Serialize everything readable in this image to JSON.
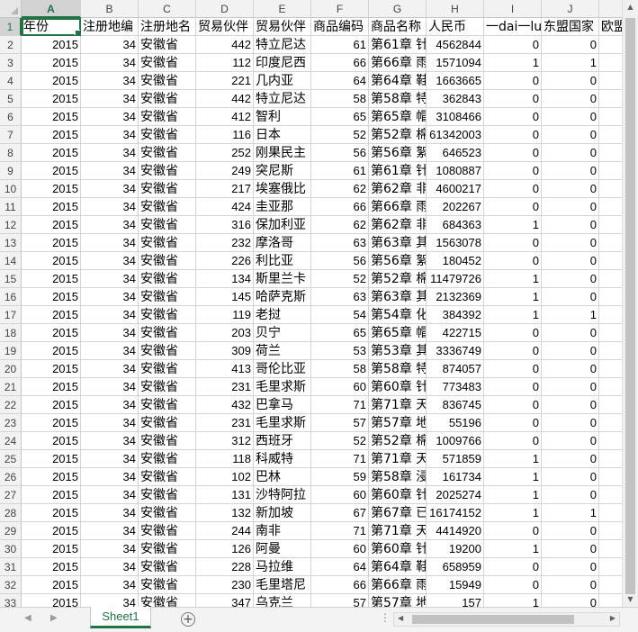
{
  "columns": [
    {
      "letter": "A",
      "width": 66
    },
    {
      "letter": "B",
      "width": 64
    },
    {
      "letter": "C",
      "width": 64
    },
    {
      "letter": "D",
      "width": 64
    },
    {
      "letter": "E",
      "width": 64
    },
    {
      "letter": "F",
      "width": 64
    },
    {
      "letter": "G",
      "width": 64
    },
    {
      "letter": "H",
      "width": 64
    },
    {
      "letter": "I",
      "width": 64
    },
    {
      "letter": "J",
      "width": 64
    },
    {
      "letter": "",
      "width": 30
    }
  ],
  "header_row": [
    "年份",
    "注册地编",
    "注册地名",
    "贸易伙伴",
    "贸易伙伴",
    "商品编码",
    "商品名称",
    "人民币",
    "一dai一lu",
    "东盟国家",
    "欧盟"
  ],
  "col_align": [
    "num",
    "num",
    "txt",
    "num",
    "txt",
    "num",
    "txt",
    "num",
    "num",
    "num",
    "num"
  ],
  "rows": [
    [
      "2015",
      "34",
      "安徽省",
      "442",
      "特立尼达",
      "61",
      "第61章 针",
      "4562844",
      "0",
      "0",
      ""
    ],
    [
      "2015",
      "34",
      "安徽省",
      "112",
      "印度尼西",
      "66",
      "第66章 雨",
      "1571094",
      "1",
      "1",
      ""
    ],
    [
      "2015",
      "34",
      "安徽省",
      "221",
      "几内亚",
      "64",
      "第64章 鞋",
      "1663665",
      "0",
      "0",
      ""
    ],
    [
      "2015",
      "34",
      "安徽省",
      "442",
      "特立尼达",
      "58",
      "第58章 特",
      "362843",
      "0",
      "0",
      ""
    ],
    [
      "2015",
      "34",
      "安徽省",
      "412",
      "智利",
      "65",
      "第65章 帽",
      "3108466",
      "0",
      "0",
      ""
    ],
    [
      "2015",
      "34",
      "安徽省",
      "116",
      "日本",
      "52",
      "第52章 棉",
      "61342003",
      "0",
      "0",
      ""
    ],
    [
      "2015",
      "34",
      "安徽省",
      "252",
      "刚果民主",
      "56",
      "第56章 絮",
      "646523",
      "0",
      "0",
      ""
    ],
    [
      "2015",
      "34",
      "安徽省",
      "249",
      "突尼斯",
      "61",
      "第61章 针",
      "1080887",
      "0",
      "0",
      ""
    ],
    [
      "2015",
      "34",
      "安徽省",
      "217",
      "埃塞俄比",
      "62",
      "第62章 非",
      "4600217",
      "0",
      "0",
      ""
    ],
    [
      "2015",
      "34",
      "安徽省",
      "424",
      "圭亚那",
      "66",
      "第66章 雨",
      "202267",
      "0",
      "0",
      ""
    ],
    [
      "2015",
      "34",
      "安徽省",
      "316",
      "保加利亚",
      "62",
      "第62章 非",
      "684363",
      "1",
      "0",
      ""
    ],
    [
      "2015",
      "34",
      "安徽省",
      "232",
      "摩洛哥",
      "63",
      "第63章 其",
      "1563078",
      "0",
      "0",
      ""
    ],
    [
      "2015",
      "34",
      "安徽省",
      "226",
      "利比亚",
      "56",
      "第56章 絮",
      "180452",
      "0",
      "0",
      ""
    ],
    [
      "2015",
      "34",
      "安徽省",
      "134",
      "斯里兰卡",
      "52",
      "第52章 棉",
      "11479726",
      "1",
      "0",
      ""
    ],
    [
      "2015",
      "34",
      "安徽省",
      "145",
      "哈萨克斯",
      "63",
      "第63章 其",
      "2132369",
      "1",
      "0",
      ""
    ],
    [
      "2015",
      "34",
      "安徽省",
      "119",
      "老挝",
      "54",
      "第54章 化",
      "384392",
      "1",
      "1",
      ""
    ],
    [
      "2015",
      "34",
      "安徽省",
      "203",
      "贝宁",
      "65",
      "第65章 帽",
      "422715",
      "0",
      "0",
      ""
    ],
    [
      "2015",
      "34",
      "安徽省",
      "309",
      "荷兰",
      "53",
      "第53章 其",
      "3336749",
      "0",
      "0",
      ""
    ],
    [
      "2015",
      "34",
      "安徽省",
      "413",
      "哥伦比亚",
      "58",
      "第58章 特",
      "874057",
      "0",
      "0",
      ""
    ],
    [
      "2015",
      "34",
      "安徽省",
      "231",
      "毛里求斯",
      "60",
      "第60章 针",
      "773483",
      "0",
      "0",
      ""
    ],
    [
      "2015",
      "34",
      "安徽省",
      "432",
      "巴拿马",
      "71",
      "第71章 天",
      "836745",
      "0",
      "0",
      ""
    ],
    [
      "2015",
      "34",
      "安徽省",
      "231",
      "毛里求斯",
      "57",
      "第57章 地",
      "55196",
      "0",
      "0",
      ""
    ],
    [
      "2015",
      "34",
      "安徽省",
      "312",
      "西班牙",
      "52",
      "第52章 棉",
      "1009766",
      "0",
      "0",
      ""
    ],
    [
      "2015",
      "34",
      "安徽省",
      "118",
      "科威特",
      "71",
      "第71章 天",
      "571859",
      "1",
      "0",
      ""
    ],
    [
      "2015",
      "34",
      "安徽省",
      "102",
      "巴林",
      "59",
      "第58章 浸",
      "161734",
      "1",
      "0",
      ""
    ],
    [
      "2015",
      "34",
      "安徽省",
      "131",
      "沙特阿拉",
      "60",
      "第60章 针",
      "2025274",
      "1",
      "0",
      ""
    ],
    [
      "2015",
      "34",
      "安徽省",
      "132",
      "新加坡",
      "67",
      "第67章 已",
      "16174152",
      "1",
      "1",
      ""
    ],
    [
      "2015",
      "34",
      "安徽省",
      "244",
      "南非",
      "71",
      "第71章 天",
      "4414920",
      "0",
      "0",
      ""
    ],
    [
      "2015",
      "34",
      "安徽省",
      "126",
      "阿曼",
      "60",
      "第60章 针",
      "19200",
      "1",
      "0",
      ""
    ],
    [
      "2015",
      "34",
      "安徽省",
      "228",
      "马拉维",
      "64",
      "第64章 鞋",
      "658959",
      "0",
      "0",
      ""
    ],
    [
      "2015",
      "34",
      "安徽省",
      "230",
      "毛里塔尼",
      "66",
      "第66章 雨",
      "15949",
      "0",
      "0",
      ""
    ],
    [
      "2015",
      "34",
      "安徽省",
      "347",
      "乌克兰",
      "57",
      "第57章 地",
      "157",
      "1",
      "0",
      ""
    ]
  ],
  "sheet_tab": "Sheet1",
  "icons": {
    "prev_sheet": "◀",
    "next_sheet": "▶",
    "add_sheet": "+",
    "scroll_up": "▲",
    "scroll_down": "▼",
    "scroll_left": "◀",
    "scroll_right": "▶",
    "more": "⋮"
  },
  "colors": {
    "accent": "#217346"
  }
}
